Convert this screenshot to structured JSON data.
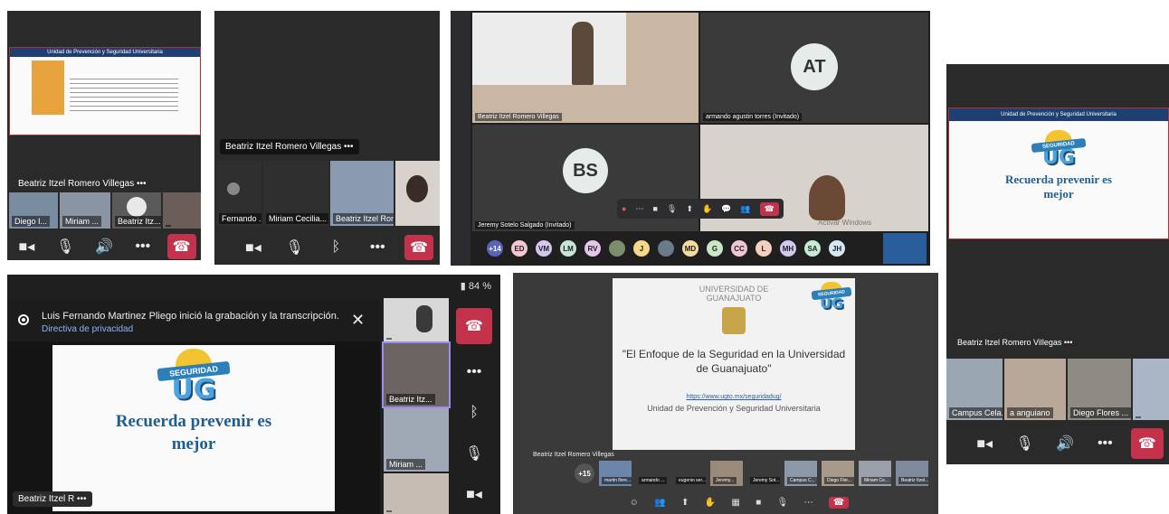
{
  "panel1": {
    "slide_header": "Unidad de Prevención y Seguridad Universitaria",
    "presenter": "Beatriz Itzel Romero Villegas",
    "more": "•••",
    "thumbs": [
      "Diego I... ",
      "Miriam ...",
      "Beatriz Itz...",
      ""
    ]
  },
  "panel2": {
    "presenter": "Beatriz Itzel Romero Villegas",
    "more": "•••",
    "thumbs": [
      "Fernando ...",
      "Miriam Cecilia...",
      "Beatriz Itzel Rome..."
    ]
  },
  "panel3": {
    "tile_names": [
      "Beatriz Itzel Romero Villegas",
      "armando agustin torres (Invitado)",
      "Jeremy Sotelo Salgado (Invitado)"
    ],
    "avatar_at": "AT",
    "avatar_bs": "BS",
    "watermark": "Activar Windows",
    "bottom_avatars": [
      "+14",
      "ED",
      "VM",
      "LM",
      "RV",
      "",
      "J",
      "",
      "MD",
      "G",
      "CC",
      "L",
      "MH",
      "SA",
      "JH"
    ]
  },
  "panel4": {
    "battery": "84 %",
    "notice_text": "Luis Fernando Martinez Pliego inició la grabación y la transcripción.",
    "notice_link": "Directiva de privacidad",
    "slide_band": "SEGURIDAD",
    "slide_letters": "UG",
    "slide_text": "Recuerda prevenir es mejor",
    "presenter": "Beatriz Itzel R",
    "more": "•••",
    "thumbs": [
      "",
      "Beatriz Itz...",
      "Miriam ...",
      ""
    ]
  },
  "panel5": {
    "university": "UNIVERSIDAD DE GUANAJUATO",
    "slide_band": "SEGURIDAD",
    "slide_letters": "UG",
    "title": "\"El Enfoque de la Seguridad  en la Universidad de Guanajuato\"",
    "url": "https://www.ugto.mx/seguridadug/",
    "unit": "Unidad de Prevención y Seguridad Universitaria",
    "presenter": "Beatriz Itzel Romero Villegas",
    "thumbs": [
      "+15",
      "martin flore...",
      "armando ...",
      "eugenio ser...",
      "Jeremy...",
      "Jeremy Sot...",
      "Campus C...",
      "Diego Flor...",
      "Miriam Ce...",
      "Beatriz Itzel..."
    ]
  },
  "panel6": {
    "slide_header": "Unidad de Prevención y Seguridad Universitaria",
    "slide_band": "SEGURIDAD",
    "slide_letters": "UG",
    "slide_text": "Recuerda prevenir es mejor",
    "presenter": "Beatriz Itzel Romero Villegas",
    "more": "•••",
    "thumbs": [
      "Campus Cela...",
      "a anguiano",
      "Diego Flores ...",
      ""
    ]
  },
  "icons": {
    "camera": "■◂",
    "mic_off": "🎙",
    "speaker": "🔊",
    "bluetooth": "ᛒ",
    "more": "•••",
    "hangup": "☎"
  },
  "colors": {
    "hangup": "#c4314b",
    "teams_dark": "#1f1f1f",
    "slide_blue": "#1f5e8f",
    "ug_yellow": "#f4c430"
  }
}
